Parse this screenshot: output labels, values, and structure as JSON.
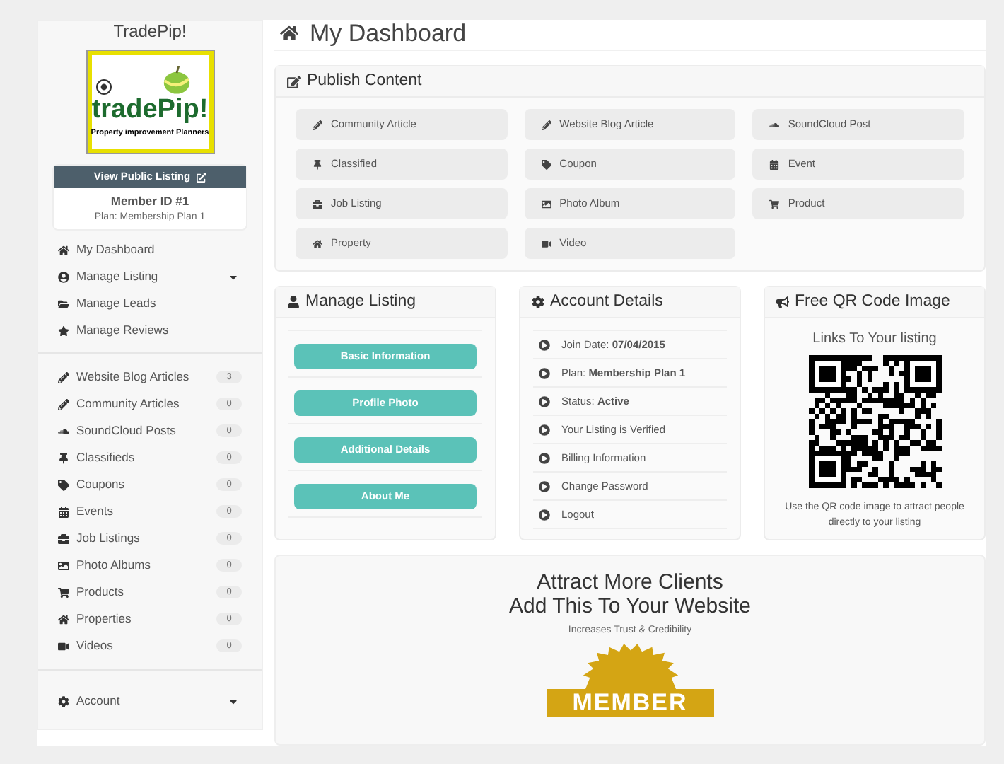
{
  "sidebar": {
    "site_title": "TradePip!",
    "logo": {
      "wordmark": "tradePip!",
      "tagline": "Property improvement Planners"
    },
    "view_button": "View Public Listing",
    "member_id": "Member ID #1",
    "plan": "Plan: Membership Plan 1",
    "nav": [
      {
        "label": "My Dashboard",
        "dropdown": false
      },
      {
        "label": "Manage Listing",
        "dropdown": true
      },
      {
        "label": "Manage Leads",
        "dropdown": false
      },
      {
        "label": "Manage Reviews",
        "dropdown": false
      }
    ],
    "content": [
      {
        "label": "Website Blog Articles",
        "count": "3"
      },
      {
        "label": "Community Articles",
        "count": "0"
      },
      {
        "label": "SoundCloud Posts",
        "count": "0"
      },
      {
        "label": "Classifieds",
        "count": "0"
      },
      {
        "label": "Coupons",
        "count": "0"
      },
      {
        "label": "Events",
        "count": "0"
      },
      {
        "label": "Job Listings",
        "count": "0"
      },
      {
        "label": "Photo Albums",
        "count": "0"
      },
      {
        "label": "Products",
        "count": "0"
      },
      {
        "label": "Properties",
        "count": "0"
      },
      {
        "label": "Videos",
        "count": "0"
      }
    ],
    "account": {
      "label": "Account",
      "dropdown": true
    }
  },
  "page_title": "My Dashboard",
  "publish": {
    "title": "Publish Content",
    "buttons": [
      "Community Article",
      "Website Blog Article",
      "SoundCloud Post",
      "Classified",
      "Coupon",
      "Event",
      "Job Listing",
      "Photo Album",
      "Product",
      "Property",
      "Video"
    ]
  },
  "manage_listing": {
    "title": "Manage Listing",
    "buttons": [
      "Basic Information",
      "Profile Photo",
      "Additional Details",
      "About Me"
    ]
  },
  "account_details": {
    "title": "Account Details",
    "items": [
      "Join Date: **07/04/2015**",
      "Plan: **Membership Plan 1**",
      "Status: **Active**",
      "Your Listing is Verified",
      "Billing Information",
      "Change Password",
      "Logout"
    ]
  },
  "qr": {
    "title": "Free QR Code Image",
    "heading": "Links To Your listing",
    "caption": "Use the QR code image to attract people directly to your listing"
  },
  "promo": {
    "line1": "Attract More Clients",
    "line2": "Add This To Your Website",
    "subtitle": "Increases Trust & Credibility",
    "badge": "MEMBER"
  }
}
